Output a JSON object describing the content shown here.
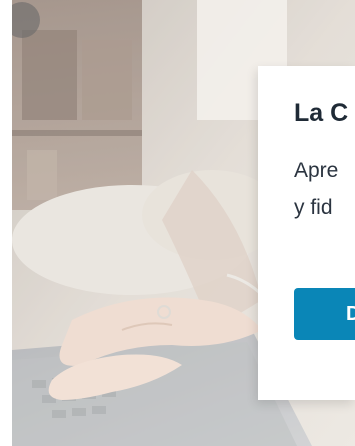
{
  "card": {
    "title": "La C",
    "text_line1": "Apre",
    "text_line2": "y fid",
    "button_label": "D"
  },
  "colors": {
    "button_bg": "#0a86b7",
    "title_color": "#1f2a36"
  },
  "hero": {
    "image_subject": "hands-typing-on-laptop"
  }
}
